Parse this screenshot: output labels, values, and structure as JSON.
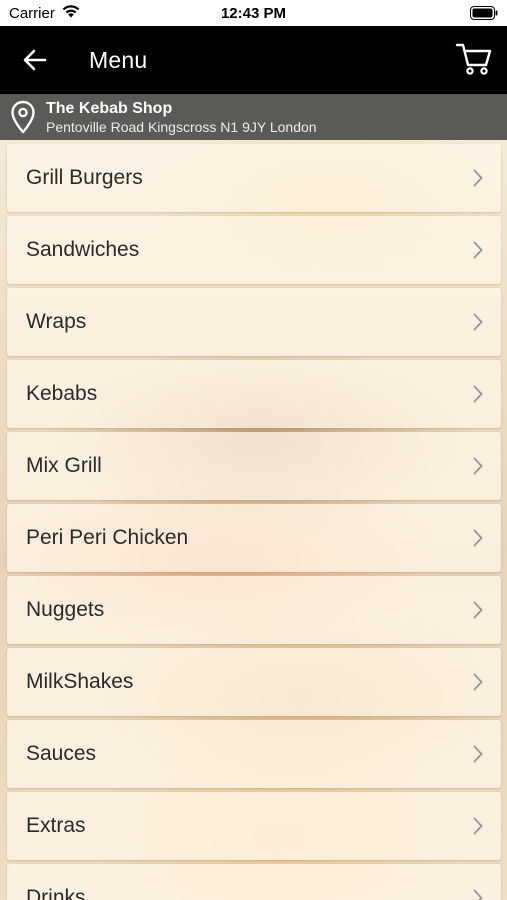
{
  "status_bar": {
    "carrier": "Carrier",
    "time": "12:43 PM"
  },
  "nav": {
    "title": "Menu",
    "back_icon": "arrow-left-icon",
    "cart_icon": "cart-icon"
  },
  "location": {
    "name": "The Kebab Shop",
    "address": "Pentoville Road Kingscross N1 9JY London"
  },
  "menu": {
    "items": [
      {
        "label": "Grill Burgers"
      },
      {
        "label": "Sandwiches"
      },
      {
        "label": "Wraps"
      },
      {
        "label": "Kebabs"
      },
      {
        "label": "Mix Grill"
      },
      {
        "label": "Peri Peri Chicken"
      },
      {
        "label": "Nuggets"
      },
      {
        "label": "MilkShakes"
      },
      {
        "label": "Sauces"
      },
      {
        "label": "Extras"
      },
      {
        "label": "Drinks"
      }
    ]
  },
  "colors": {
    "nav_background": "#000000",
    "location_background": "#5c5a57",
    "item_background": "#fff6e8"
  }
}
